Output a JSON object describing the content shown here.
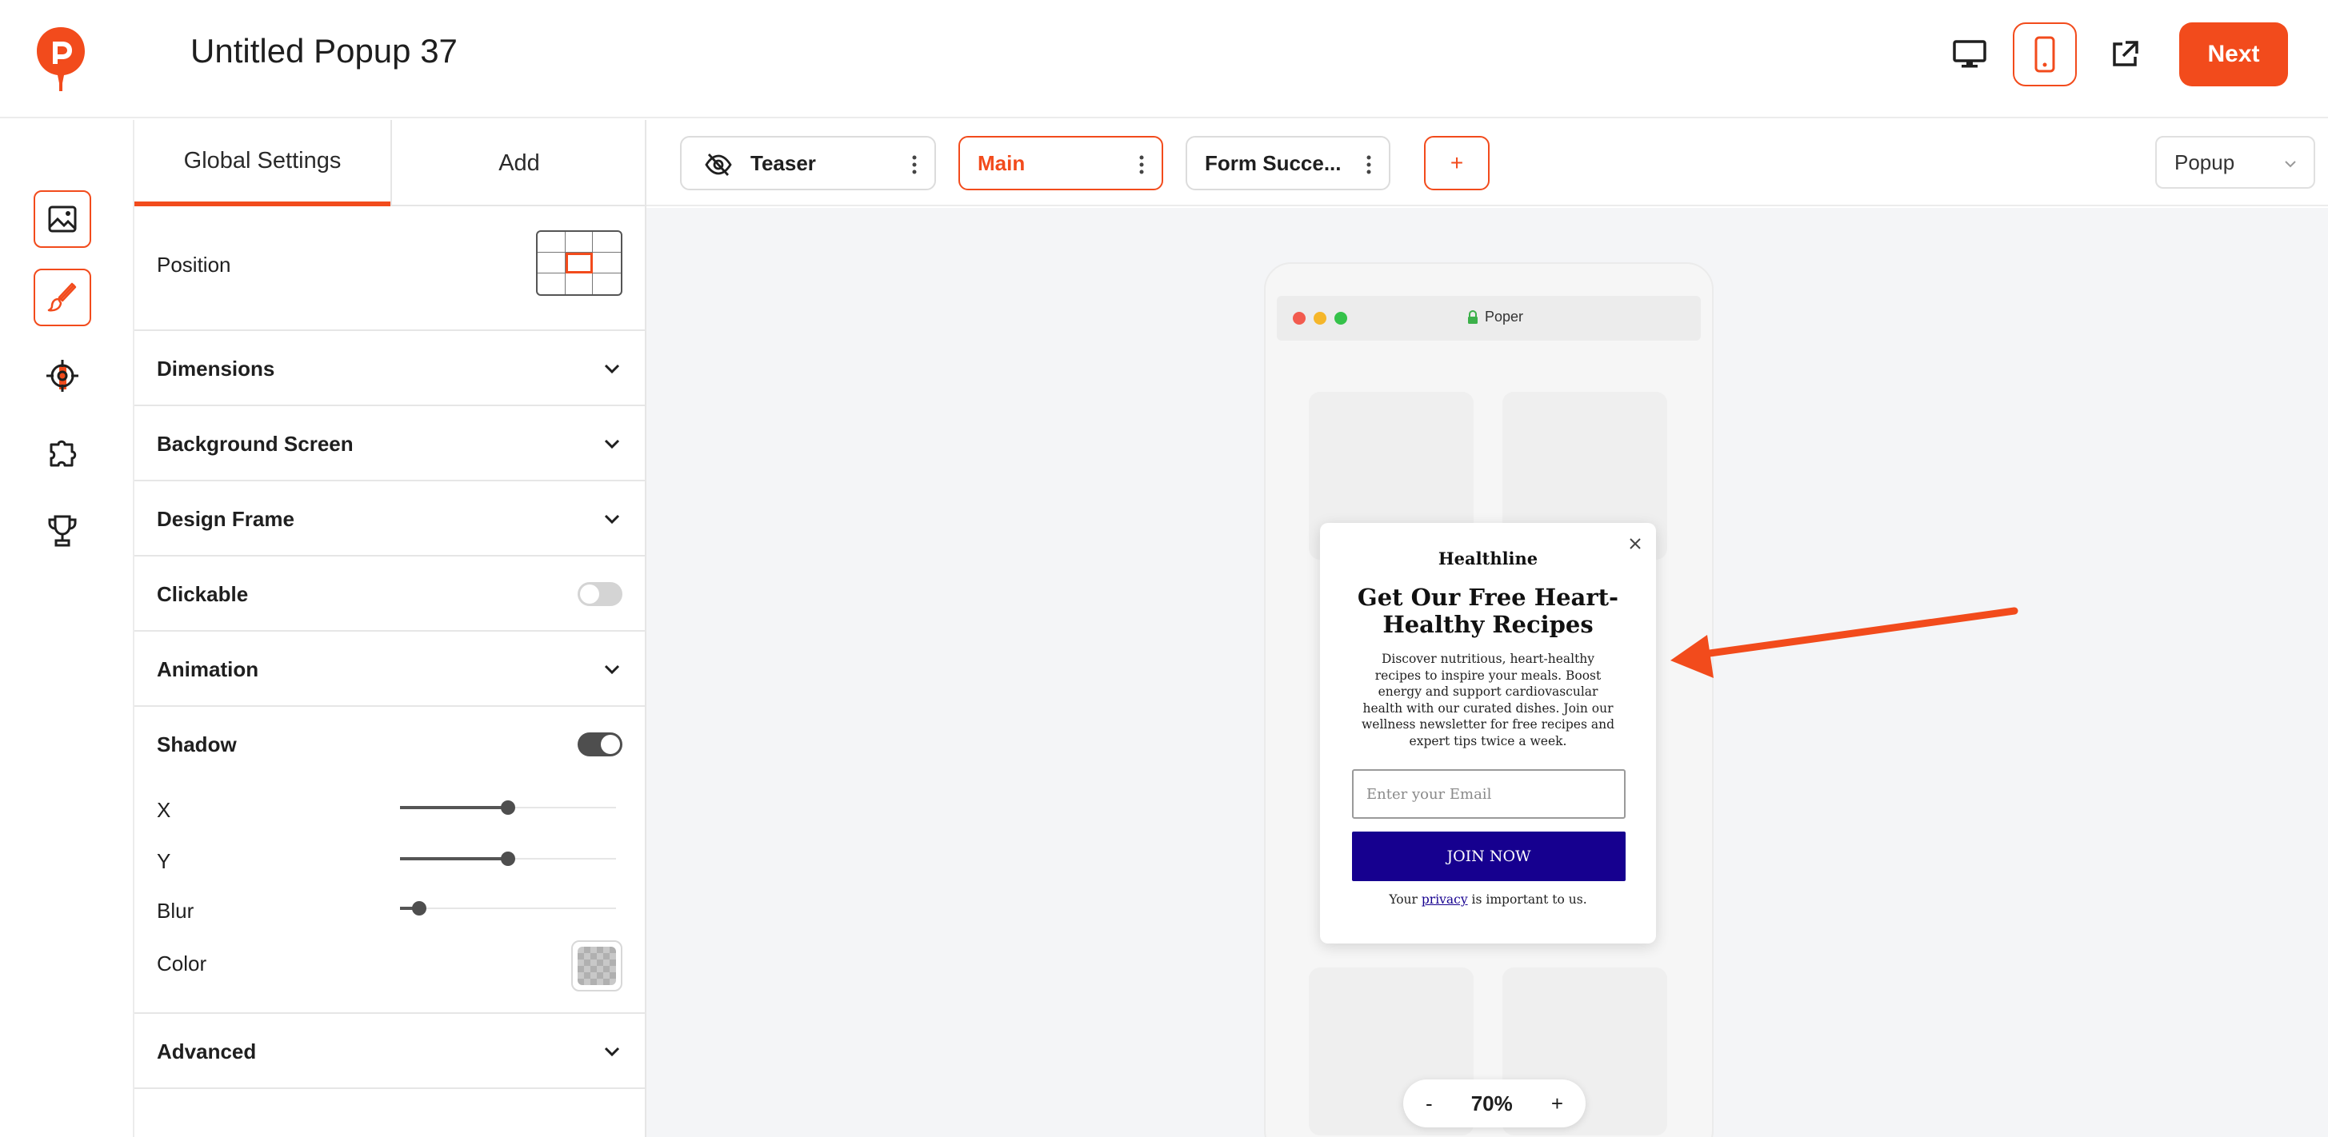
{
  "app": {
    "title": "Untitled Popup 37",
    "brand_color": "#f24b1c",
    "next_label": "Next",
    "top_icons": [
      "desktop-preview-icon",
      "mobile-preview-icon",
      "open-external-icon"
    ]
  },
  "rail": {
    "items": [
      "image-icon",
      "brush-icon",
      "target-icon",
      "puzzle-icon",
      "trophy-icon"
    ],
    "active": "brush-icon"
  },
  "panel": {
    "tabs": [
      {
        "label": "Global Settings",
        "active": true
      },
      {
        "label": "Add",
        "active": false
      }
    ],
    "position_label": "Position",
    "position_selected": "center",
    "sections": {
      "dimensions": "Dimensions",
      "background_screen": "Background Screen",
      "design_frame": "Design Frame",
      "clickable": "Clickable",
      "animation": "Animation",
      "shadow": "Shadow",
      "advanced": "Advanced"
    },
    "clickable_on": false,
    "shadow_on": true,
    "shadow_controls": [
      {
        "label": "X",
        "value_fraction": 0.5
      },
      {
        "label": "Y",
        "value_fraction": 0.5
      },
      {
        "label": "Blur",
        "value_fraction": 0.09
      }
    ],
    "color_label": "Color"
  },
  "steps": {
    "items": [
      {
        "label": "Teaser",
        "icon": "eye-off-icon",
        "active": false
      },
      {
        "label": "Main",
        "active": true
      },
      {
        "label": "Form Succe...",
        "active": false
      }
    ],
    "add_label": "+",
    "type_select": "Popup"
  },
  "preview": {
    "browser_title": "Poper",
    "popup": {
      "brand": "Healthline",
      "heading": "Get Our Free Heart-Healthy Recipes",
      "description": "Discover nutritious, heart-healthy recipes to inspire your meals. Boost energy and support cardiovascular health with our curated dishes. Join our wellness newsletter for free recipes and expert tips twice a week.",
      "email_placeholder": "Enter your Email",
      "button_label": "JOIN NOW",
      "button_color": "#16008f",
      "privacy_prefix": "Your",
      "privacy_link": "privacy",
      "privacy_suffix": "is important to us."
    },
    "zoom": {
      "minus": "-",
      "value": "70%",
      "plus": "+"
    }
  }
}
